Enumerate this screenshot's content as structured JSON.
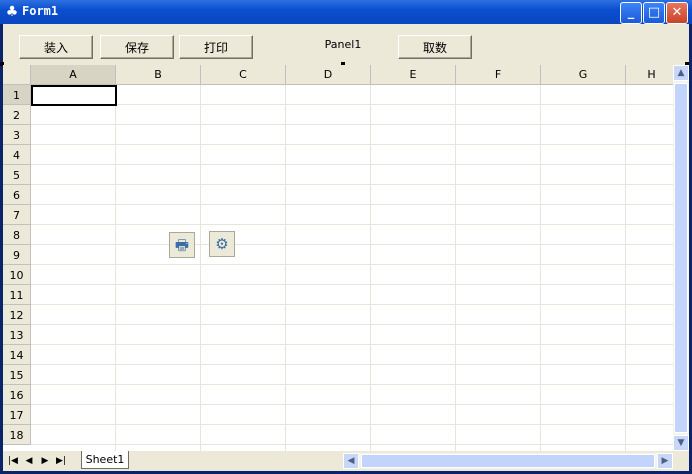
{
  "window": {
    "title": "Form1"
  },
  "toolbar": {
    "load_label": "装入",
    "save_label": "保存",
    "print_label": "打印",
    "panel_label": "Panel1",
    "fetch_label": "取数"
  },
  "grid": {
    "columns": [
      "A",
      "B",
      "C",
      "D",
      "E",
      "F",
      "G",
      "H"
    ],
    "rows": [
      "1",
      "2",
      "3",
      "4",
      "5",
      "6",
      "7",
      "8",
      "9",
      "10",
      "11",
      "12",
      "13",
      "14",
      "15",
      "16",
      "17",
      "18"
    ],
    "active_cell": "A1"
  },
  "icons": {
    "print": "printer-icon",
    "settings": "gear-icon"
  },
  "sheets": [
    "Sheet1"
  ]
}
